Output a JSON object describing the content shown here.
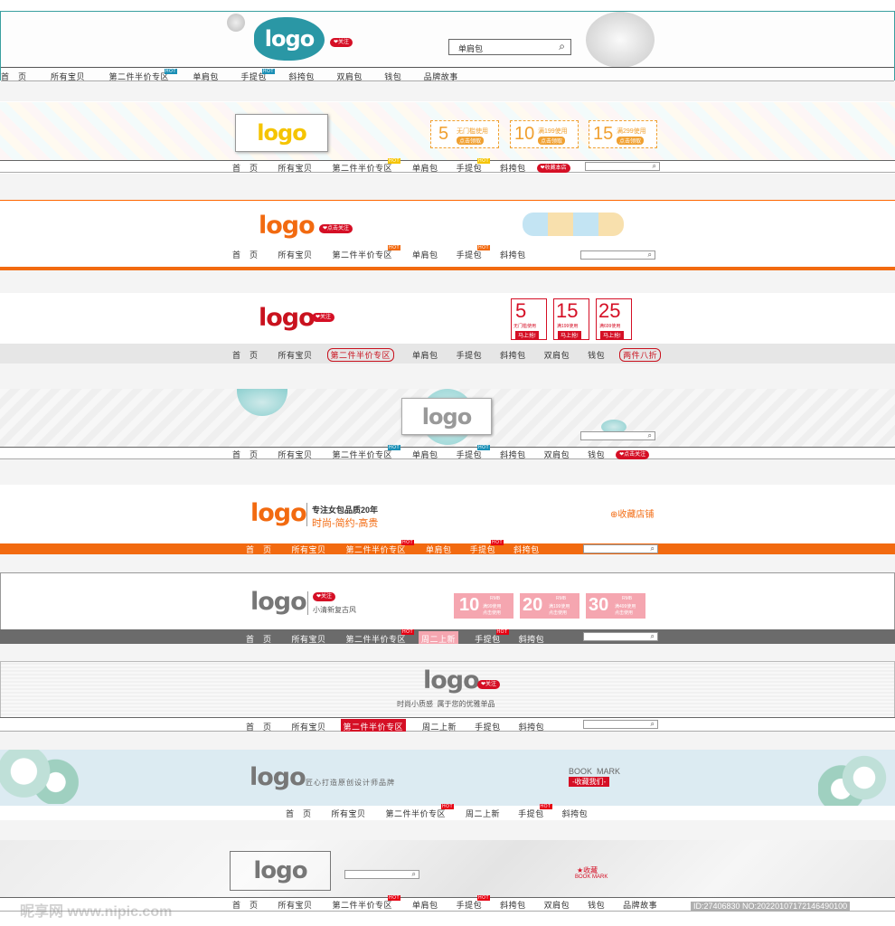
{
  "common": {
    "logo": "logo",
    "follow": "关注",
    "hot": "HOT",
    "search_icon": "search-icon",
    "heart_icon": "heart-icon"
  },
  "b1": {
    "search_value": "单肩包",
    "nav": [
      "首　页",
      "所有宝贝",
      "第二件半价专区",
      "单肩包",
      "手提包",
      "斜挎包",
      "双肩包",
      "钱包",
      "品牌故事"
    ]
  },
  "b2": {
    "coupons": [
      {
        "amount": "5",
        "line1": "无门槛使用",
        "line2": "点击领取"
      },
      {
        "amount": "10",
        "line1": "满199使用",
        "line2": "点击领取"
      },
      {
        "amount": "15",
        "line1": "满299使用",
        "line2": "点击领取"
      }
    ],
    "nav": [
      "首　页",
      "所有宝贝",
      "第二件半价专区",
      "单肩包",
      "手提包",
      "斜挎包"
    ],
    "collect": "收藏本店"
  },
  "b3": {
    "follow": "点击关注",
    "nav": [
      "首　页",
      "所有宝贝",
      "第二件半价专区",
      "单肩包",
      "手提包",
      "斜挎包"
    ]
  },
  "b4": {
    "coupons": [
      {
        "amount": "5",
        "line1": "无门槛使用",
        "line2": "马上抢!"
      },
      {
        "amount": "15",
        "line1": "满199使用",
        "line2": "马上抢!"
      },
      {
        "amount": "25",
        "line1": "满699使用",
        "line2": "马上抢!"
      }
    ],
    "nav": [
      "首　页",
      "所有宝贝",
      "第二件半价专区",
      "单肩包",
      "手提包",
      "斜挎包",
      "双肩包",
      "钱包",
      "两件八折"
    ]
  },
  "b5": {
    "nav": [
      "首　页",
      "所有宝贝",
      "第二件半价专区",
      "单肩包",
      "手提包",
      "斜挎包",
      "双肩包",
      "钱包"
    ],
    "follow": "点击关注"
  },
  "b6": {
    "slogan1": "专注女包品质20年",
    "slogan2": "时尚-简约-高贵",
    "collect": "收藏店铺",
    "nav": [
      "首　页",
      "所有宝贝",
      "第二件半价专区",
      "单肩包",
      "手提包",
      "斜挎包"
    ]
  },
  "b7": {
    "tagline": "小清新复古风",
    "coupons": [
      {
        "amount": "10",
        "unit": "RMB",
        "line1": "满99使用",
        "line2": "点击使用"
      },
      {
        "amount": "20",
        "unit": "RMB",
        "line1": "满199使用",
        "line2": "点击使用"
      },
      {
        "amount": "30",
        "unit": "RMB",
        "line1": "满499使用",
        "line2": "点击使用"
      }
    ],
    "nav": [
      "首　页",
      "所有宝贝",
      "第二件半价专区",
      "周二上新",
      "手提包",
      "斜挎包"
    ]
  },
  "b8": {
    "tagline": "时尚小质感  属于您的优雅单品",
    "nav": [
      "首　页",
      "所有宝贝",
      "第二件半价专区",
      "周二上新",
      "手提包",
      "斜挎包"
    ]
  },
  "b9": {
    "tagline": "匠心打造原创设计师品牌",
    "bookmark": "BOOK  MARK",
    "collect": "-收藏我们-",
    "nav": [
      "首　页",
      "所有宝贝",
      "第二件半价专区",
      "周二上新",
      "手提包",
      "斜挎包"
    ]
  },
  "b10": {
    "collect": "收藏",
    "bookmark": "BOOK MARK",
    "nav": [
      "首　页",
      "所有宝贝",
      "第二件半价专区",
      "单肩包",
      "手提包",
      "斜挎包",
      "双肩包",
      "钱包",
      "品牌故事"
    ]
  },
  "watermark": {
    "site": "昵享网 www.nipic.com",
    "id": "ID:27406830 NO:20220107172146490100"
  }
}
